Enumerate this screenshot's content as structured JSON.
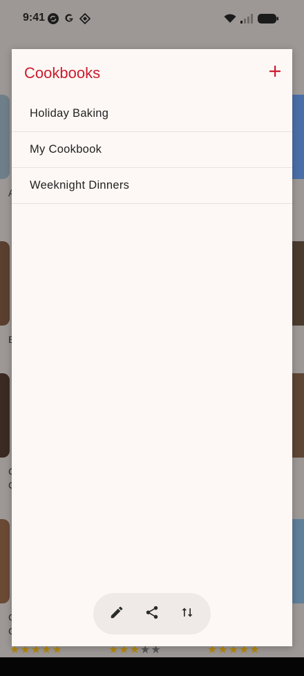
{
  "status_bar": {
    "time": "9:41",
    "left_icons": [
      "sync-icon",
      "google-icon",
      "diamond-app-icon"
    ],
    "right_icons": [
      "wifi-icon",
      "cellular-signal-icon",
      "battery-icon"
    ]
  },
  "sheet": {
    "title": "Cookbooks",
    "add_icon": "plus-icon",
    "cookbooks": [
      {
        "label": "Holiday Baking"
      },
      {
        "label": "My Cookbook"
      },
      {
        "label": "Weeknight Dinners"
      }
    ],
    "actions": [
      {
        "name": "edit-button",
        "icon": "pencil-icon"
      },
      {
        "name": "share-button",
        "icon": "share-icon"
      },
      {
        "name": "sort-button",
        "icon": "sort-arrows-icon"
      }
    ]
  },
  "background": {
    "partial_letters": [
      "A",
      "E",
      "C",
      "C",
      "C",
      "C"
    ],
    "ratings": [
      {
        "stars_filled": 5,
        "stars_total": 5
      },
      {
        "stars_filled": 3,
        "stars_total": 5
      },
      {
        "stars_filled": 5,
        "stars_total": 5
      }
    ]
  },
  "colors": {
    "accent": "#cc1b2e",
    "sheet_background": "#fdf8f5",
    "scrim": "#9d9896",
    "action_bar": "#efeae7",
    "star": "#b4860c"
  }
}
